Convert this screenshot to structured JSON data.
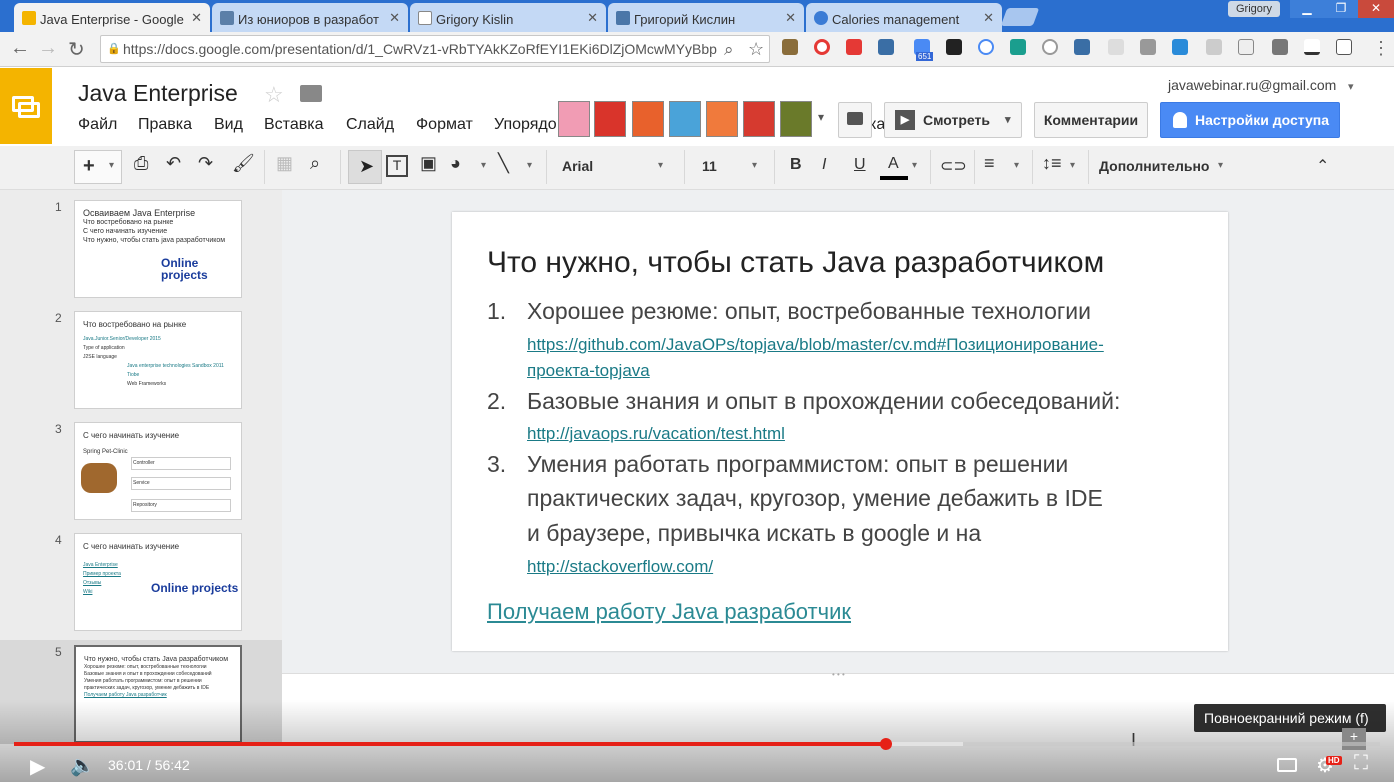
{
  "browser": {
    "tabs": [
      {
        "title": "Java Enterprise - Google",
        "color": "#f4b400",
        "active": true
      },
      {
        "title": "Из юниоров в разработ",
        "color": "#5b7fa8"
      },
      {
        "title": "Grigory Kislin",
        "color": "#888888"
      },
      {
        "title": "Григорий Кислин",
        "color": "#4a76a8"
      },
      {
        "title": "Calories management",
        "color": "#3a7bd5"
      }
    ],
    "user": "Grigory",
    "url": "https://docs.google.com/presentation/d/1_CwRVz1-vRbTYAkKZoRfEYI1EKi6DlZjOMcwMYyBbp",
    "ext_badge": "651"
  },
  "docs": {
    "title": "Java Enterprise",
    "account": "javawebinar.ru@gmail.com",
    "menu": [
      "Файл",
      "Правка",
      "Вид",
      "Вставка",
      "Слайд",
      "Формат",
      "Упорядо",
      "ка"
    ],
    "present_label": "Смотреть",
    "comments_label": "Комментарии",
    "share_label": "Настройки доступа",
    "font_name": "Arial",
    "font_size": "11",
    "more_label": "Дополнительно"
  },
  "thumbnails": [
    {
      "num": "1",
      "title": "Осваиваем Java Enterprise",
      "lines": [
        "Что востребовано на рынке",
        "С чего начинать изучение",
        "Что нужно, чтобы стать java разработчиком"
      ],
      "logo": "Online projects"
    },
    {
      "num": "2",
      "title": "Что востребовано на рынке",
      "lines": [
        "Java.Junior.Senior/Developer 2015",
        "Type of application",
        "J2SE language",
        "Java enterprise technologies Sandbox 2011",
        "Tiobe",
        "Web Frameworks"
      ]
    },
    {
      "num": "3",
      "title": "С чего начинать изучение",
      "lines": [
        "Spring Pet-Clinic",
        "Controller",
        "Service",
        "Repository"
      ]
    },
    {
      "num": "4",
      "title": "С чего начинать изучение",
      "lines": [
        "Java Enterprise",
        "Пример проекта",
        "Отзывы",
        "Wiki"
      ],
      "logo": "Online projects"
    },
    {
      "num": "5",
      "title": "Что нужно, чтобы стать Java разработчиком",
      "lines": [
        "Хорошее резюме: опыт, востребованные технологии",
        "Базовые знания и опыт в прохождении собеседований",
        "Умения работать программистом: опыт в решении",
        "практических задач, кругозор, умение дебажить в IDE",
        "Получаем работу Java разработчик"
      ]
    }
  ],
  "slide": {
    "title": "Что нужно, чтобы стать Java разработчиком",
    "items": [
      {
        "num": "1.",
        "lines": [
          "Хорошее резюме: опыт, востребованные технологии"
        ],
        "links": [
          "https://github.com/JavaOPs/topjava/blob/master/cv.md#Позиционирование-",
          "проекта-topjava"
        ]
      },
      {
        "num": "2.",
        "lines": [
          "Базовые знания и опыт в прохождении собеседований:"
        ],
        "links": [
          "http://javaops.ru/vacation/test.html"
        ]
      },
      {
        "num": "3.",
        "lines": [
          "Умения работать программистом: опыт в решении",
          "практических задач, кругозор, умение дебажить в IDE",
          "и браузере, привычка искать в google и на"
        ],
        "links": [
          "http://stackoverflow.com/"
        ]
      }
    ],
    "footer_link": "Получаем работу Java разработчик"
  },
  "video": {
    "time": "36:01 / 56:42",
    "played_fraction": 0.638,
    "buffered_fraction": 0.695,
    "tooltip": "Повноекранний режим (f)",
    "hd_badge": "HD"
  }
}
